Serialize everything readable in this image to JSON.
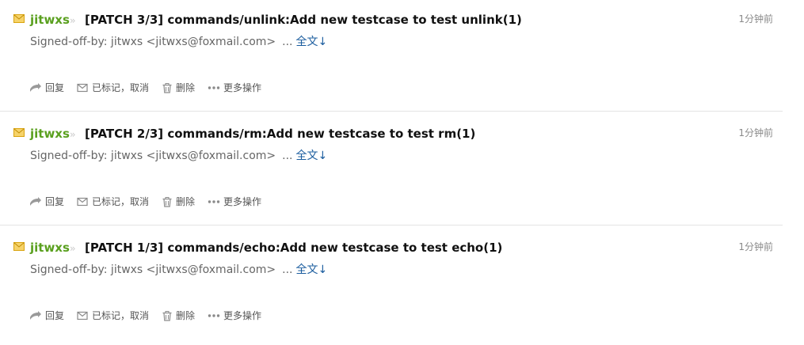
{
  "mails": [
    {
      "sender": "jitwxs",
      "subject": "[PATCH 3/3] commands/unlink:Add new testcase to test unlink(1)",
      "time": "1分钟前",
      "preview": "Signed-off-by: jitwxs <jitwxs@foxmail.com>",
      "ellipsis": "...",
      "fulltext": "全文↓"
    },
    {
      "sender": "jitwxs",
      "subject": "[PATCH 2/3] commands/rm:Add new testcase to test rm(1)",
      "time": "1分钟前",
      "preview": "Signed-off-by: jitwxs <jitwxs@foxmail.com>",
      "ellipsis": "...",
      "fulltext": "全文↓"
    },
    {
      "sender": "jitwxs",
      "subject": "[PATCH 1/3] commands/echo:Add new testcase to test echo(1)",
      "time": "1分钟前",
      "preview": "Signed-off-by: jitwxs <jitwxs@foxmail.com>",
      "ellipsis": "...",
      "fulltext": "全文↓"
    }
  ],
  "actions": {
    "reply": "回复",
    "marked": "已标记，取消",
    "delete": "删除",
    "more": "更多操作"
  },
  "colors": {
    "sender": "#5aa01f",
    "link": "#1a5c9e",
    "envelope": "#e8b317"
  },
  "icons": {
    "envelope": "envelope-icon",
    "chevron": "double-chevron-right-icon",
    "reply": "reply-arrow-icon",
    "mark": "mail-mark-icon",
    "delete": "trash-icon",
    "more": "more-dots-icon"
  }
}
